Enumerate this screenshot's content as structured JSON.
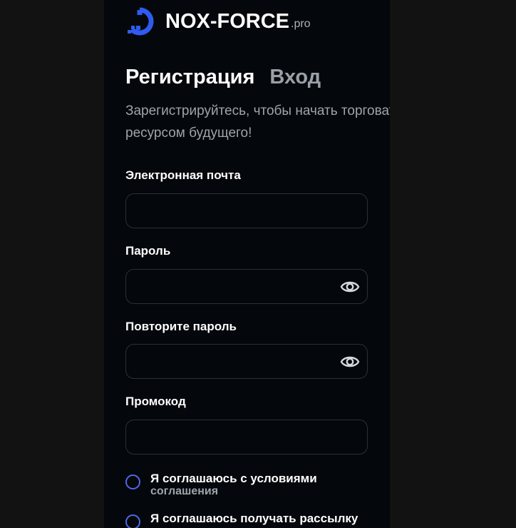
{
  "brand": {
    "name": "NOX-FORCE",
    "suffix": ".pro",
    "accent_color": "#2f5bf0"
  },
  "tabs": [
    {
      "label": "Регистрация",
      "active": true
    },
    {
      "label": "Вход",
      "active": false
    }
  ],
  "subtitle": "Зарегистрируйтесь, чтобы начать торговать ресурсом будущего!",
  "form": {
    "email": {
      "label": "Электронная почта",
      "value": "",
      "placeholder": ""
    },
    "password": {
      "label": "Пароль",
      "value": "",
      "placeholder": "",
      "icon": "eye-icon"
    },
    "password_repeat": {
      "label": "Повторите пароль",
      "value": "",
      "placeholder": "",
      "icon": "eye-icon"
    },
    "promo": {
      "label": "Промокод",
      "value": "",
      "placeholder": ""
    }
  },
  "agreements": [
    {
      "text": "Я соглашаюсь с условиями",
      "subtext": "соглашения",
      "checked": false
    },
    {
      "text": "Я соглашаюсь получать рассылку",
      "checked": false
    }
  ]
}
